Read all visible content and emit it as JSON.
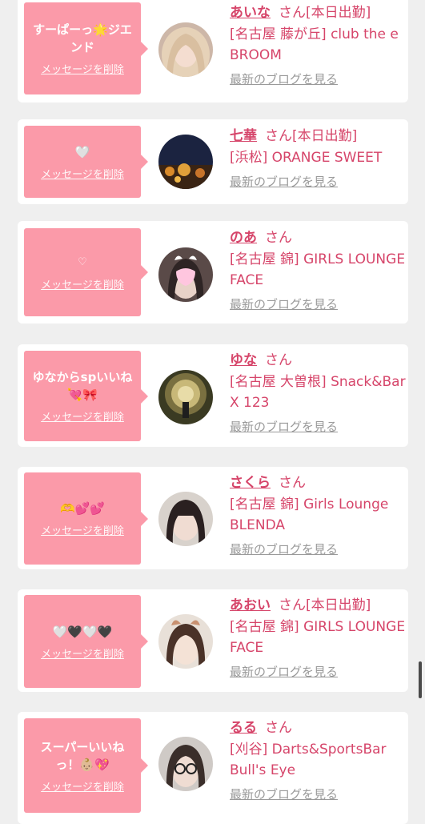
{
  "cards": [
    {
      "message": "すーぱーっ🌟ジエンド",
      "delete_label": "メッセージを削除",
      "name": "あいな",
      "honorific": "さん",
      "status": "[本日出勤]",
      "store": "[名古屋 藤が丘] club the e BROOM",
      "blog_label": "最新のブログを見る"
    },
    {
      "message": "🤍",
      "delete_label": "メッセージを削除",
      "name": "七華",
      "honorific": "さん",
      "status": "[本日出勤]",
      "store": "[浜松] ORANGE SWEET",
      "blog_label": "最新のブログを見る"
    },
    {
      "message": "♡",
      "delete_label": "メッセージを削除",
      "name": "のあ",
      "honorific": "さん",
      "status": "",
      "store": "[名古屋 錦] GIRLS LOUNGE FACE",
      "blog_label": "最新のブログを見る"
    },
    {
      "message": "ゆなからspいいね💘🎀",
      "delete_label": "メッセージを削除",
      "name": "ゆな",
      "honorific": "さん",
      "status": "",
      "store": "[名古屋 大曽根] Snack&Bar X 123",
      "blog_label": "最新のブログを見る"
    },
    {
      "message": "🫶💕💕",
      "delete_label": "メッセージを削除",
      "name": "さくら",
      "honorific": "さん",
      "status": "",
      "store": "[名古屋 錦] Girls Lounge BLENDA",
      "blog_label": "最新のブログを見る"
    },
    {
      "message": "🤍🖤🤍🖤",
      "delete_label": "メッセージを削除",
      "name": "あおい",
      "honorific": "さん",
      "status": "[本日出勤]",
      "store": "[名古屋 錦] GIRLS LOUNGE FACE",
      "blog_label": "最新のブログを見る"
    },
    {
      "message": "スーパーいいねっ！👶🏼💖",
      "delete_label": "メッセージを削除",
      "name": "るる",
      "honorific": "さん",
      "status": "",
      "store": "[刈谷] Darts&SportsBar Bull's Eye",
      "blog_label": "最新のブログを見る"
    }
  ],
  "colors": {
    "accent": "#d6456a",
    "bubble": "#fb9aa9",
    "muted": "#9a9a9a",
    "background": "#efefef"
  }
}
